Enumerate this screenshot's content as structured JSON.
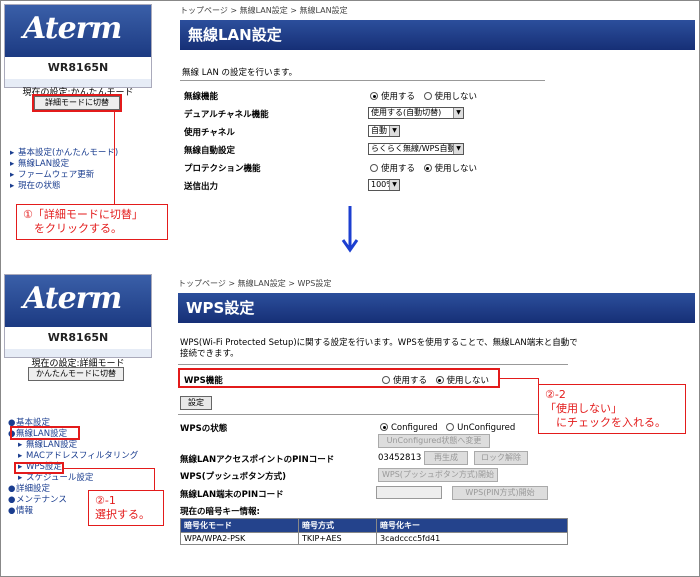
{
  "top": {
    "sidebar": {
      "logo": "Aterm",
      "model": "WR8165N",
      "mode_status": "現在の設定:かんたんモード",
      "mode_button": "詳細モードに切替",
      "nav": [
        "基本設定(かんたんモード)",
        "無線LAN設定",
        "ファームウェア更新",
        "現在の状態"
      ]
    },
    "breadcrumb": "トップページ > 無線LAN設定 > 無線LAN設定",
    "title": "無線LAN設定",
    "description": "無線 LAN の設定を行います。",
    "rows": [
      {
        "label": "無線機能",
        "opt1": "使用する",
        "opt2": "使用しない"
      },
      {
        "label": "デュアルチャネル機能",
        "select": "使用する(自動切替)"
      },
      {
        "label": "使用チャネル",
        "select": "自動"
      },
      {
        "label": "無線自動設定",
        "select": "らくらく無線/WPS自動"
      },
      {
        "label": "プロテクション機能",
        "opt1": "使用する",
        "opt2": "使用しない"
      },
      {
        "label": "送信出力",
        "select": "100%"
      }
    ],
    "callout": "①「詳細モードに切替」\n　をクリックする。"
  },
  "bottom": {
    "sidebar": {
      "logo": "Aterm",
      "model": "WR8165N",
      "mode_status": "現在の設定:詳細モード",
      "mode_button": "かんたんモードに切替",
      "nav": [
        {
          "label": "基本設定",
          "sub": false
        },
        {
          "label": "無線LAN設定",
          "sub": false
        },
        {
          "label": "無線LAN設定",
          "sub": true
        },
        {
          "label": "MACアドレスフィルタリング",
          "sub": true
        },
        {
          "label": "WPS設定",
          "sub": true
        },
        {
          "label": "スケジュール設定",
          "sub": true
        },
        {
          "label": "詳細設定",
          "sub": false
        },
        {
          "label": "メンテナンス",
          "sub": false
        },
        {
          "label": "情報",
          "sub": false
        }
      ]
    },
    "breadcrumb": "トップページ > 無線LAN設定 > WPS設定",
    "title": "WPS設定",
    "description": "WPS(Wi-Fi Protected Setup)に関する設定を行います。WPSを使用することで、無線LAN端末と自動で接続できます。",
    "wps_label": "WPS機能",
    "wps_opt1": "使用する",
    "wps_opt2": "使用しない",
    "set_button": "設定",
    "state_label": "WPSの状態",
    "state_opt1": "Configured",
    "state_opt2": "UnConfigured",
    "unconfigured_button": "UnConfigured状態へ変更",
    "pin_label": "無線LANアクセスポイントのPINコード",
    "pin_value": "03452813",
    "regen_button": "再生成",
    "unlock_button": "ロック解除",
    "push_label": "WPS(プッシュボタン方式)",
    "push_button": "WPS(プッシュボタン方式)開始",
    "client_pin_label": "無線LAN端末のPINコード",
    "pin_start_button": "WPS(PIN方式)開始",
    "key_info_label": "現在の暗号キー情報:",
    "key_table": {
      "headers": [
        "暗号化モード",
        "暗号方式",
        "暗号化キー"
      ],
      "row": [
        "WPA/WPA2-PSK",
        "TKIP+AES",
        "3cadcccc5fd41"
      ]
    },
    "callout_right": "②-2\n「使用しない」\n　にチェックを入れる。",
    "callout_left": "②-1\n選択する。"
  },
  "colors": {
    "accent": "#e31b1b",
    "title_bar": "#1f3f8a",
    "link": "#1a3d8f"
  }
}
